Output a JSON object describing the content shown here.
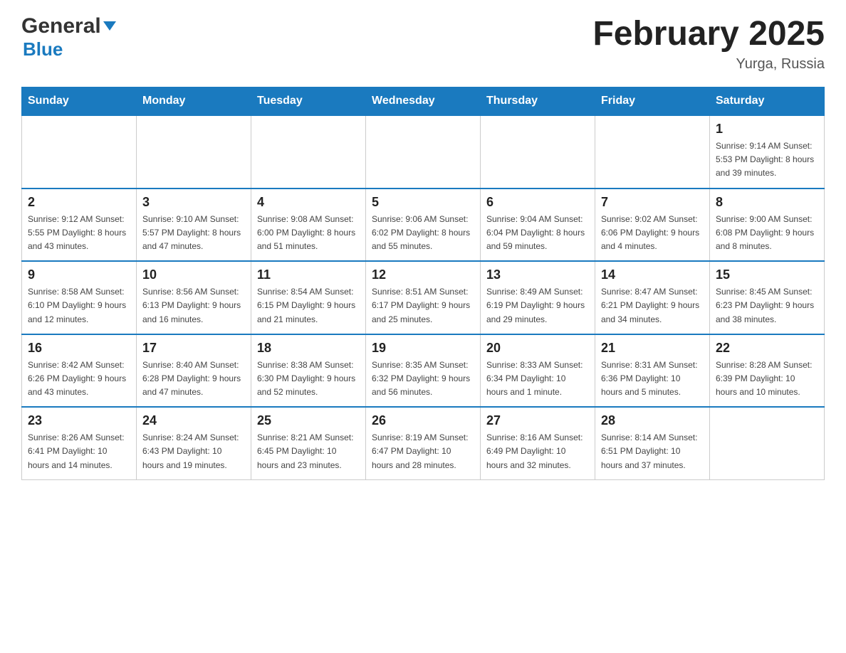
{
  "header": {
    "logo": {
      "general_text": "General",
      "blue_text": "Blue"
    },
    "title": "February 2025",
    "subtitle": "Yurga, Russia"
  },
  "calendar": {
    "days_of_week": [
      "Sunday",
      "Monday",
      "Tuesday",
      "Wednesday",
      "Thursday",
      "Friday",
      "Saturday"
    ],
    "weeks": [
      {
        "days": [
          {
            "date": "",
            "info": ""
          },
          {
            "date": "",
            "info": ""
          },
          {
            "date": "",
            "info": ""
          },
          {
            "date": "",
            "info": ""
          },
          {
            "date": "",
            "info": ""
          },
          {
            "date": "",
            "info": ""
          },
          {
            "date": "1",
            "info": "Sunrise: 9:14 AM\nSunset: 5:53 PM\nDaylight: 8 hours\nand 39 minutes."
          }
        ]
      },
      {
        "days": [
          {
            "date": "2",
            "info": "Sunrise: 9:12 AM\nSunset: 5:55 PM\nDaylight: 8 hours\nand 43 minutes."
          },
          {
            "date": "3",
            "info": "Sunrise: 9:10 AM\nSunset: 5:57 PM\nDaylight: 8 hours\nand 47 minutes."
          },
          {
            "date": "4",
            "info": "Sunrise: 9:08 AM\nSunset: 6:00 PM\nDaylight: 8 hours\nand 51 minutes."
          },
          {
            "date": "5",
            "info": "Sunrise: 9:06 AM\nSunset: 6:02 PM\nDaylight: 8 hours\nand 55 minutes."
          },
          {
            "date": "6",
            "info": "Sunrise: 9:04 AM\nSunset: 6:04 PM\nDaylight: 8 hours\nand 59 minutes."
          },
          {
            "date": "7",
            "info": "Sunrise: 9:02 AM\nSunset: 6:06 PM\nDaylight: 9 hours\nand 4 minutes."
          },
          {
            "date": "8",
            "info": "Sunrise: 9:00 AM\nSunset: 6:08 PM\nDaylight: 9 hours\nand 8 minutes."
          }
        ]
      },
      {
        "days": [
          {
            "date": "9",
            "info": "Sunrise: 8:58 AM\nSunset: 6:10 PM\nDaylight: 9 hours\nand 12 minutes."
          },
          {
            "date": "10",
            "info": "Sunrise: 8:56 AM\nSunset: 6:13 PM\nDaylight: 9 hours\nand 16 minutes."
          },
          {
            "date": "11",
            "info": "Sunrise: 8:54 AM\nSunset: 6:15 PM\nDaylight: 9 hours\nand 21 minutes."
          },
          {
            "date": "12",
            "info": "Sunrise: 8:51 AM\nSunset: 6:17 PM\nDaylight: 9 hours\nand 25 minutes."
          },
          {
            "date": "13",
            "info": "Sunrise: 8:49 AM\nSunset: 6:19 PM\nDaylight: 9 hours\nand 29 minutes."
          },
          {
            "date": "14",
            "info": "Sunrise: 8:47 AM\nSunset: 6:21 PM\nDaylight: 9 hours\nand 34 minutes."
          },
          {
            "date": "15",
            "info": "Sunrise: 8:45 AM\nSunset: 6:23 PM\nDaylight: 9 hours\nand 38 minutes."
          }
        ]
      },
      {
        "days": [
          {
            "date": "16",
            "info": "Sunrise: 8:42 AM\nSunset: 6:26 PM\nDaylight: 9 hours\nand 43 minutes."
          },
          {
            "date": "17",
            "info": "Sunrise: 8:40 AM\nSunset: 6:28 PM\nDaylight: 9 hours\nand 47 minutes."
          },
          {
            "date": "18",
            "info": "Sunrise: 8:38 AM\nSunset: 6:30 PM\nDaylight: 9 hours\nand 52 minutes."
          },
          {
            "date": "19",
            "info": "Sunrise: 8:35 AM\nSunset: 6:32 PM\nDaylight: 9 hours\nand 56 minutes."
          },
          {
            "date": "20",
            "info": "Sunrise: 8:33 AM\nSunset: 6:34 PM\nDaylight: 10 hours\nand 1 minute."
          },
          {
            "date": "21",
            "info": "Sunrise: 8:31 AM\nSunset: 6:36 PM\nDaylight: 10 hours\nand 5 minutes."
          },
          {
            "date": "22",
            "info": "Sunrise: 8:28 AM\nSunset: 6:39 PM\nDaylight: 10 hours\nand 10 minutes."
          }
        ]
      },
      {
        "days": [
          {
            "date": "23",
            "info": "Sunrise: 8:26 AM\nSunset: 6:41 PM\nDaylight: 10 hours\nand 14 minutes."
          },
          {
            "date": "24",
            "info": "Sunrise: 8:24 AM\nSunset: 6:43 PM\nDaylight: 10 hours\nand 19 minutes."
          },
          {
            "date": "25",
            "info": "Sunrise: 8:21 AM\nSunset: 6:45 PM\nDaylight: 10 hours\nand 23 minutes."
          },
          {
            "date": "26",
            "info": "Sunrise: 8:19 AM\nSunset: 6:47 PM\nDaylight: 10 hours\nand 28 minutes."
          },
          {
            "date": "27",
            "info": "Sunrise: 8:16 AM\nSunset: 6:49 PM\nDaylight: 10 hours\nand 32 minutes."
          },
          {
            "date": "28",
            "info": "Sunrise: 8:14 AM\nSunset: 6:51 PM\nDaylight: 10 hours\nand 37 minutes."
          },
          {
            "date": "",
            "info": ""
          }
        ]
      }
    ]
  }
}
